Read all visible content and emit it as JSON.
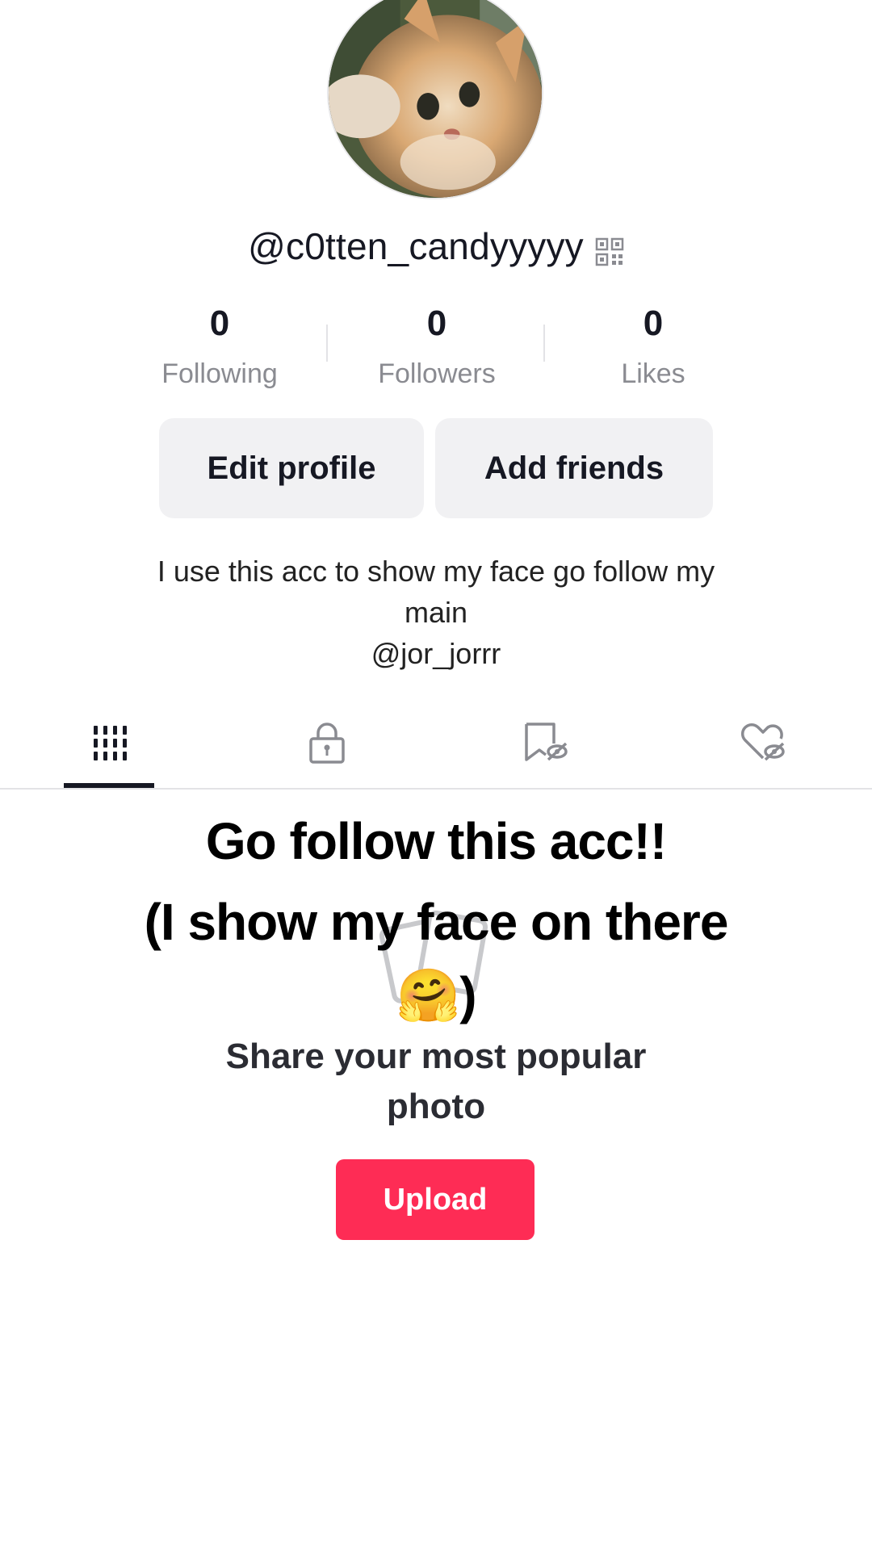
{
  "profile": {
    "username": "@c0tten_candyyyyy",
    "qr_icon": "qr-code-icon",
    "avatar_description": "kitten-avatar"
  },
  "stats": [
    {
      "value": "0",
      "label": "Following"
    },
    {
      "value": "0",
      "label": "Followers"
    },
    {
      "value": "0",
      "label": "Likes"
    }
  ],
  "buttons": {
    "edit_profile": "Edit profile",
    "add_friends": "Add friends"
  },
  "bio": {
    "line1": "I use this acc to show my face go follow my",
    "line2": "main",
    "line3": "@jor_jorrr"
  },
  "tabs": [
    {
      "icon": "grid-icon",
      "active": true
    },
    {
      "icon": "lock-icon",
      "active": false
    },
    {
      "icon": "bookmark-hidden-icon",
      "active": false
    },
    {
      "icon": "heart-hidden-icon",
      "active": false
    }
  ],
  "overlay": {
    "line1": "Go follow this acc!!",
    "line2": "(I show my face on there",
    "line3_emoji": "🤗",
    "line3_paren": ")"
  },
  "empty_state": {
    "line1": "Share your most popular",
    "line2": "photo",
    "upload_label": "Upload"
  },
  "colors": {
    "accent": "#fe2c55",
    "text": "#161823",
    "muted": "#8a8b91",
    "button_bg": "#f1f1f3"
  }
}
